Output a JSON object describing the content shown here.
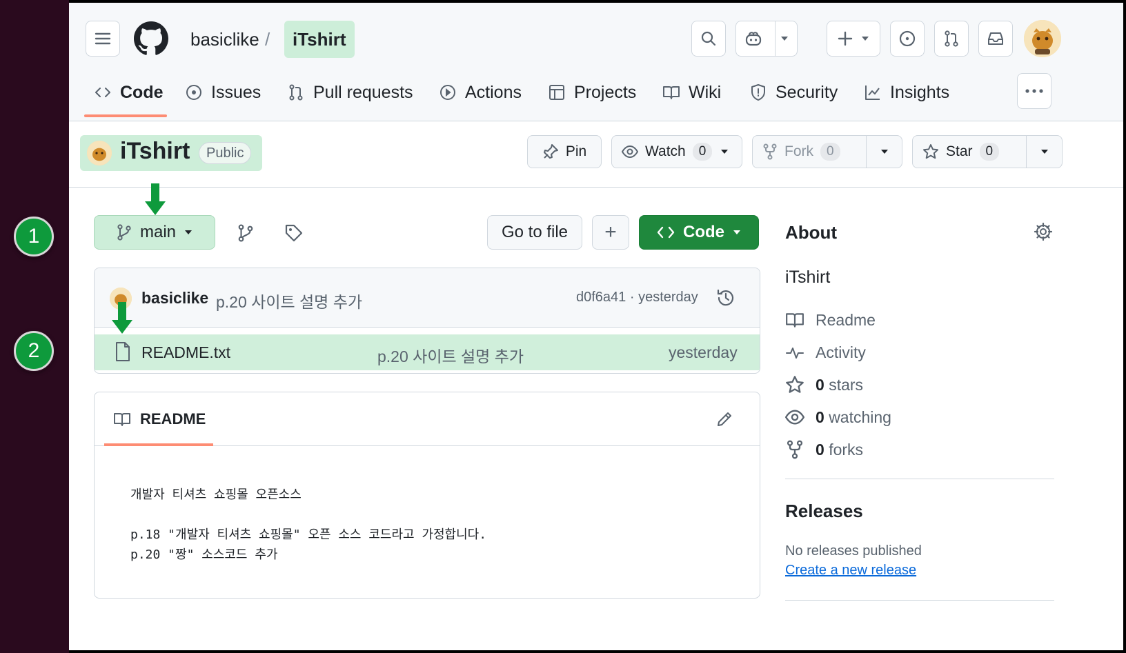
{
  "badges": [
    "1",
    "2"
  ],
  "header": {
    "owner": "basiclike",
    "slash": "/",
    "repo": "iTshirt"
  },
  "nav": {
    "code": "Code",
    "issues": "Issues",
    "pulls": "Pull requests",
    "actions": "Actions",
    "projects": "Projects",
    "wiki": "Wiki",
    "security": "Security",
    "insights": "Insights"
  },
  "repo": {
    "name": "iTshirt",
    "visibility": "Public",
    "pin": "Pin",
    "watch": "Watch",
    "watch_count": "0",
    "fork": "Fork",
    "fork_count": "0",
    "star": "Star",
    "star_count": "0"
  },
  "branch_bar": {
    "branch": "main",
    "go_to_file": "Go to file",
    "add": "+",
    "code": "Code"
  },
  "commit": {
    "author": "basiclike",
    "message": "p.20 사이트 설명 추가",
    "hash_time": "d0f6a41 · yesterday"
  },
  "files": [
    {
      "name": "README.txt",
      "message": "p.20 사이트 설명 추가",
      "time": "yesterday"
    }
  ],
  "readme": {
    "title": "README",
    "lines": [
      "개발자 티셔츠 쇼핑몰 오픈소스",
      "p.18 \"개발자 티셔츠 쇼핑몰\" 오픈 소스 코드라고 가정합니다.",
      "p.20 \"짱\" 소스코드 추가"
    ]
  },
  "about": {
    "title": "About",
    "description": "iTshirt",
    "readme": "Readme",
    "activity": "Activity",
    "stars_num": "0",
    "stars": "stars",
    "watching_num": "0",
    "watching": "watching",
    "forks_num": "0",
    "forks": "forks"
  },
  "releases": {
    "title": "Releases",
    "none": "No releases published",
    "create": "Create a new release"
  },
  "colors": {
    "highlight": "#cdeed9",
    "code_button": "#1f883d",
    "badge": "#0e9a3c",
    "strip": "#2a0a1e"
  }
}
